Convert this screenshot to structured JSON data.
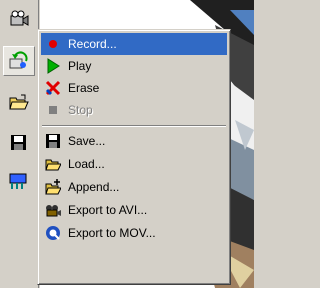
{
  "colors": {
    "menu_bg": "#d4d0c8",
    "selection": "#316ac5"
  },
  "toolbar": {
    "buttons": [
      {
        "icon": "camera-record-icon"
      },
      {
        "icon": "refresh-icon"
      },
      {
        "icon": "open-folder-icon"
      },
      {
        "icon": "floppy-save-icon"
      },
      {
        "icon": "export-icon"
      }
    ]
  },
  "menu": {
    "items": [
      {
        "label": "Record...",
        "icon": "record-dot-icon",
        "selected": true,
        "enabled": true
      },
      {
        "label": "Play",
        "icon": "play-icon",
        "selected": false,
        "enabled": true
      },
      {
        "label": "Erase",
        "icon": "erase-x-icon",
        "selected": false,
        "enabled": true
      },
      {
        "label": "Stop",
        "icon": "stop-square-icon",
        "selected": false,
        "enabled": false
      },
      {
        "label": "Save...",
        "icon": "floppy-save-icon",
        "selected": false,
        "enabled": true
      },
      {
        "label": "Load...",
        "icon": "open-folder-icon",
        "selected": false,
        "enabled": true
      },
      {
        "label": "Append...",
        "icon": "append-folder-icon",
        "selected": false,
        "enabled": true
      },
      {
        "label": "Export to AVI...",
        "icon": "film-reel-icon",
        "selected": false,
        "enabled": true
      },
      {
        "label": "Export to MOV...",
        "icon": "quicktime-icon",
        "selected": false,
        "enabled": true
      }
    ]
  }
}
